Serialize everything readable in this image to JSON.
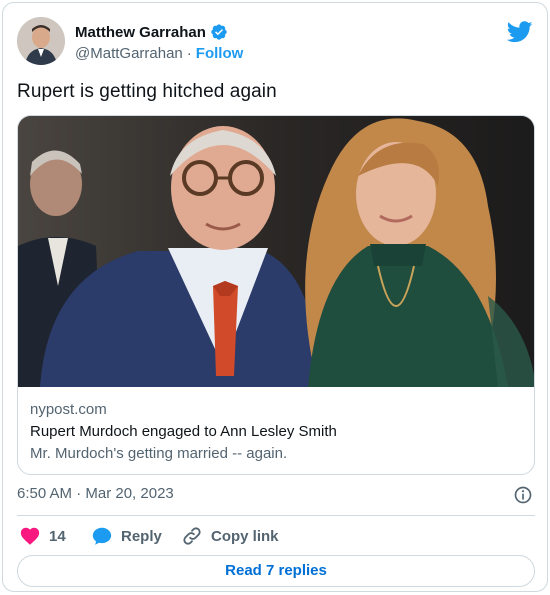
{
  "author": {
    "name": "Matthew Garrahan",
    "handle": "@MattGarrahan",
    "separator": "·",
    "follow_label": "Follow"
  },
  "tweet": {
    "text": "Rupert is getting hitched again"
  },
  "link_card": {
    "domain": "nypost.com",
    "title": "Rupert Murdoch engaged to Ann Lesley Smith",
    "description": "Mr. Murdoch's getting married -- again."
  },
  "meta": {
    "timestamp": "6:50 AM · Mar 20, 2023"
  },
  "actions": {
    "like_count": "14",
    "reply_label": "Reply",
    "copy_link_label": "Copy link",
    "read_replies_label": "Read 7 replies"
  },
  "colors": {
    "twitter_blue": "#1d9bf0",
    "like_pink": "#f91880",
    "text_primary": "#0f1419",
    "text_secondary": "#536471",
    "border": "#cfd9de"
  }
}
